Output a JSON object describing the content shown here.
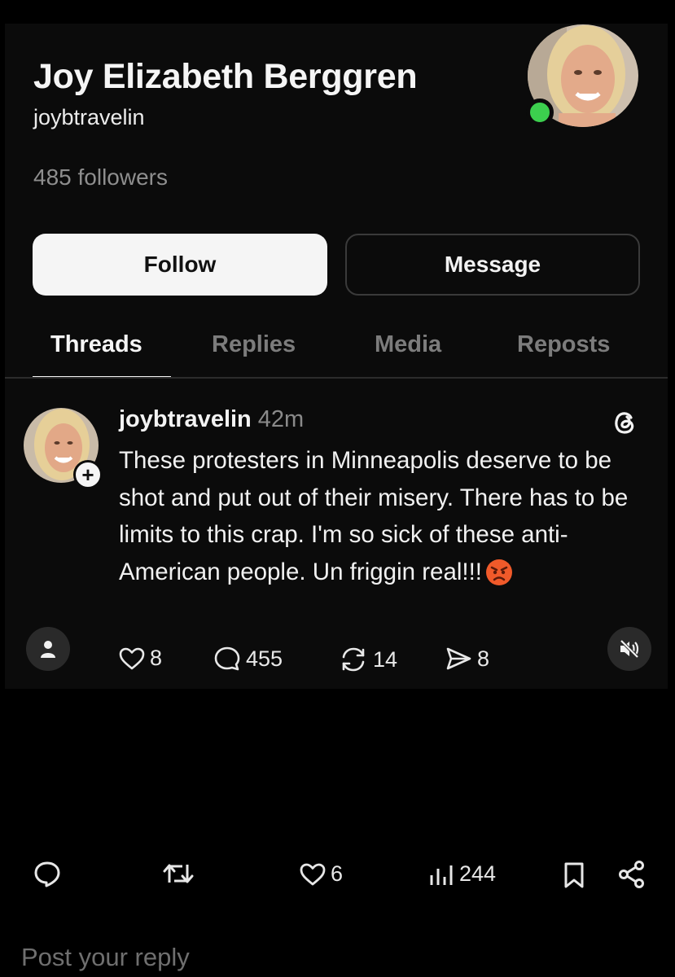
{
  "profile": {
    "name": "Joy Elizabeth Berggren",
    "handle": "joybtravelin",
    "followers": "485 followers",
    "online_color": "#3ccf4e"
  },
  "buttons": {
    "follow": "Follow",
    "message": "Message"
  },
  "tabs": [
    {
      "label": "Threads",
      "active": true
    },
    {
      "label": "Replies",
      "active": false
    },
    {
      "label": "Media",
      "active": false
    },
    {
      "label": "Reposts",
      "active": false
    }
  ],
  "post": {
    "username": "joybtravelin",
    "time": "42m",
    "text": "These protesters in Minneapolis deserve to be shot and put out of their misery. There has to be limits to this crap. I'm so sick of these anti-American people. Un friggin real!!!",
    "emoji": "angry-face-icon",
    "actions": {
      "likes": "8",
      "comments": "455",
      "reposts": "14",
      "shares": "8"
    }
  },
  "bottom_bar": {
    "likes": "6",
    "views": "244"
  },
  "reply": {
    "placeholder": "Post your reply"
  }
}
